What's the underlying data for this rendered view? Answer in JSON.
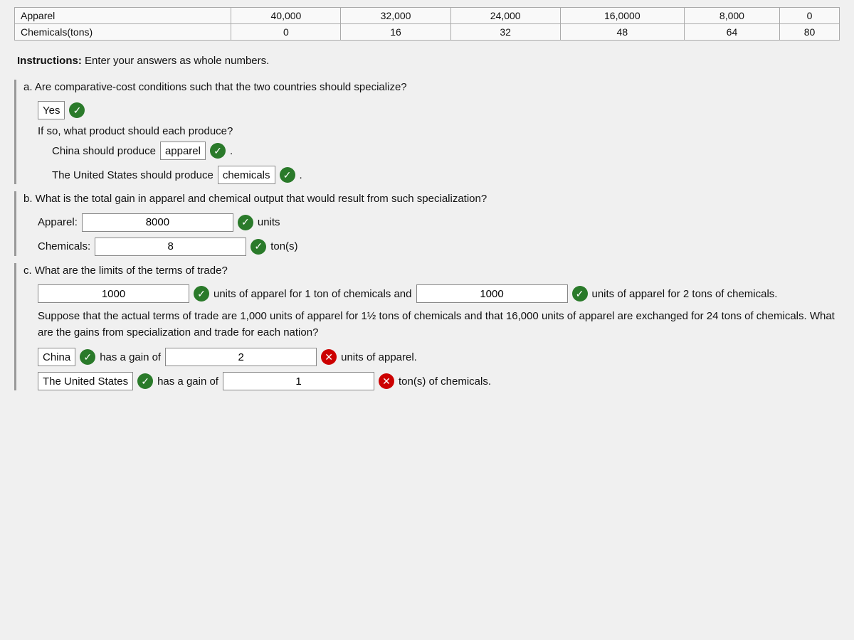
{
  "table": {
    "rows": [
      {
        "label": "Apparel",
        "cols": [
          "40,000",
          "32,000",
          "24,000",
          "16,0000",
          "8,000",
          "0"
        ]
      },
      {
        "label": "Chemicals(tons)",
        "cols": [
          "0",
          "16",
          "32",
          "48",
          "64",
          "80"
        ]
      }
    ]
  },
  "instructions": {
    "prefix": "Instructions:",
    "text": " Enter your answers as whole numbers."
  },
  "section_a": {
    "question": "a. Are comparative-cost conditions such that the two countries should specialize?",
    "yes_label": "Yes",
    "check": "✓",
    "if_so_text": "If so, what product should each produce?",
    "china_prefix": "China should produce",
    "china_value": "apparel",
    "us_prefix": "The United States should produce",
    "us_value": "chemicals"
  },
  "section_b": {
    "question": "b. What is the total gain in apparel and chemical output that would result from such specialization?",
    "apparel_label": "Apparel:",
    "apparel_value": "8000",
    "apparel_suffix": "units",
    "chemicals_label": "Chemicals:",
    "chemicals_value": "8",
    "chemicals_suffix": "ton(s)"
  },
  "section_c": {
    "question": "c. What are the limits of the terms of trade?",
    "value1": "1000",
    "middle_text": "units of apparel for 1 ton of chemicals and",
    "value2": "1000",
    "end_text": "units of apparel for 2 tons of chemicals.",
    "paragraph": "Suppose that the actual terms of trade are 1,000 units of apparel for 1½ tons of chemicals and that 16,000 units of apparel are exchanged for 24 tons of chemicals. What are the gains from specialization and trade for each nation?",
    "china_label": "China",
    "china_gain_text": "has a gain of",
    "china_gain_value": "2",
    "china_gain_suffix": "units of apparel.",
    "us_label": "The United States",
    "us_gain_text": "has a gain of",
    "us_gain_value": "1",
    "us_gain_suffix": "ton(s) of chemicals."
  }
}
